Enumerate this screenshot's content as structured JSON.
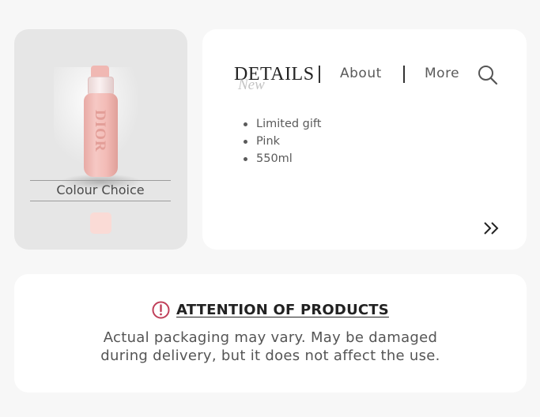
{
  "product": {
    "image_alt": "pink water bottle",
    "logo_text": "DIOR",
    "colour_choice_label": "Colour Choice",
    "swatch_color": "#fadbd6"
  },
  "details": {
    "tabs": [
      {
        "label": "DETAILS",
        "active": true
      },
      {
        "label": "About",
        "active": false
      },
      {
        "label": "More",
        "active": false
      }
    ],
    "new_overlay": "New",
    "features": [
      "Limited gift",
      "Pink",
      "550ml"
    ]
  },
  "notice": {
    "title": "ATTENTION OF PRODUCTS",
    "text": "Actual packaging may vary. May be damaged during delivery, but it does not affect the use.",
    "icon_color": "#c0405a"
  },
  "icons": {
    "search": "search-icon",
    "next": "double-chevron-right-icon",
    "alert": "alert-circle-icon"
  }
}
